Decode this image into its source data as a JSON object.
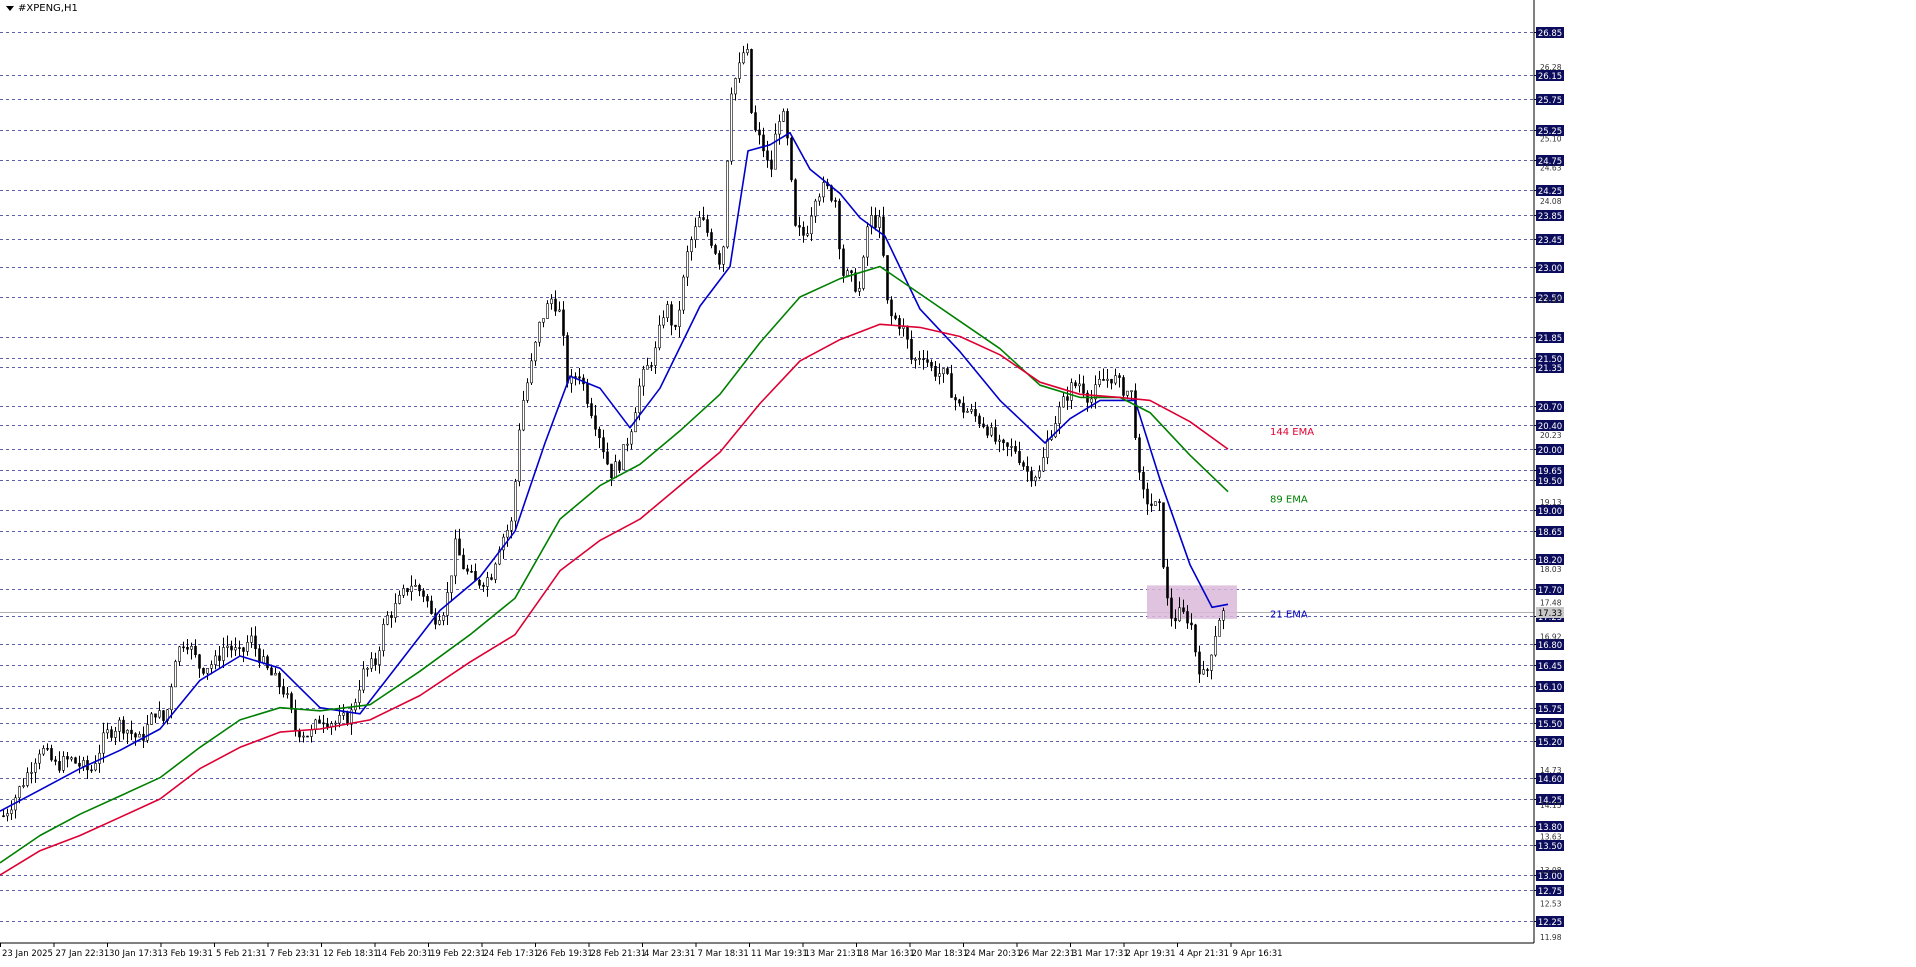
{
  "window": {
    "symbol_title": "#XPENG,H1"
  },
  "chart_data": {
    "type": "candlestick",
    "symbol": "#XPENG",
    "timeframe": "H1",
    "ylim": [
      11.9,
      27.15
    ],
    "grid": "horizontal dashed at marked levels",
    "levels": [
      "26.85",
      "26.15",
      "25.75",
      "25.25",
      "24.75",
      "24.25",
      "23.85",
      "23.45",
      "23.00",
      "22.50",
      "21.85",
      "21.50",
      "21.35",
      "20.70",
      "20.40",
      "20.00",
      "19.65",
      "19.50",
      "19.00",
      "18.65",
      "18.20",
      "17.70",
      "17.25",
      "16.80",
      "16.45",
      "16.10",
      "15.75",
      "15.50",
      "15.20",
      "14.60",
      "14.25",
      "13.80",
      "13.50",
      "13.00",
      "12.75",
      "12.25"
    ],
    "small_price_labels": [
      "26.28",
      "25.10",
      "24.63",
      "24.08",
      "22.45",
      "20.23",
      "19.13",
      "18.03",
      "17.48",
      "16.92",
      "14.73",
      "14.15",
      "13.63",
      "13.08",
      "12.53",
      "11.98"
    ],
    "current_price": "17.33",
    "x_labels": [
      "23 Jan 2025",
      "27 Jan 22:31",
      "30 Jan 17:31",
      "3 Feb 19:31",
      "5 Feb 21:31",
      "7 Feb 23:31",
      "12 Feb 18:31",
      "14 Feb 20:31",
      "19 Feb 22:31",
      "24 Feb 17:31",
      "26 Feb 19:31",
      "28 Feb 21:31",
      "4 Mar 23:31",
      "7 Mar 18:31",
      "11 Mar 19:31",
      "13 Mar 21:31",
      "18 Mar 16:31",
      "20 Mar 18:31",
      "24 Mar 20:31",
      "26 Mar 22:31",
      "31 Mar 17:31",
      "2 Apr 19:31",
      "4 Apr 21:31",
      "9 Apr 16:31"
    ],
    "x_positions": [
      0,
      53.5,
      107,
      160.5,
      214,
      267.5,
      321,
      374.5,
      428,
      481.5,
      535,
      588.5,
      642,
      695.5,
      749,
      802.5,
      856,
      909.5,
      963,
      1016.5,
      1070,
      1123.5,
      1177,
      1230.5
    ],
    "price_path": [
      [
        0,
        13.9
      ],
      [
        12,
        14.2
      ],
      [
        25,
        14.6
      ],
      [
        40,
        15.1
      ],
      [
        55,
        14.8
      ],
      [
        70,
        14.9
      ],
      [
        90,
        14.7
      ],
      [
        105,
        15.3
      ],
      [
        120,
        15.5
      ],
      [
        140,
        15.2
      ],
      [
        155,
        15.7
      ],
      [
        165,
        15.5
      ],
      [
        175,
        16.6
      ],
      [
        185,
        16.9
      ],
      [
        200,
        16.4
      ],
      [
        215,
        16.5
      ],
      [
        225,
        16.8
      ],
      [
        240,
        16.6
      ],
      [
        250,
        16.9
      ],
      [
        265,
        16.4
      ],
      [
        275,
        16.2
      ],
      [
        285,
        16.0
      ],
      [
        295,
        15.4
      ],
      [
        310,
        15.3
      ],
      [
        320,
        15.6
      ],
      [
        335,
        15.5
      ],
      [
        350,
        15.6
      ],
      [
        362,
        16.3
      ],
      [
        375,
        16.5
      ],
      [
        385,
        17.2
      ],
      [
        395,
        17.4
      ],
      [
        410,
        17.8
      ],
      [
        425,
        17.6
      ],
      [
        432,
        17.2
      ],
      [
        445,
        17.4
      ],
      [
        455,
        18.4
      ],
      [
        465,
        18.0
      ],
      [
        475,
        17.8
      ],
      [
        490,
        17.9
      ],
      [
        500,
        18.5
      ],
      [
        512,
        18.8
      ],
      [
        520,
        20.6
      ],
      [
        530,
        21.3
      ],
      [
        540,
        22.1
      ],
      [
        552,
        22.5
      ],
      [
        560,
        22.2
      ],
      [
        568,
        21.0
      ],
      [
        578,
        21.3
      ],
      [
        590,
        20.7
      ],
      [
        600,
        20.2
      ],
      [
        610,
        19.6
      ],
      [
        620,
        19.8
      ],
      [
        630,
        20.3
      ],
      [
        640,
        21.1
      ],
      [
        655,
        21.6
      ],
      [
        665,
        22.4
      ],
      [
        675,
        21.9
      ],
      [
        688,
        23.3
      ],
      [
        700,
        23.8
      ],
      [
        712,
        23.4
      ],
      [
        722,
        23.0
      ],
      [
        730,
        25.9
      ],
      [
        738,
        26.2
      ],
      [
        746,
        26.7
      ],
      [
        752,
        25.3
      ],
      [
        762,
        25.0
      ],
      [
        770,
        24.5
      ],
      [
        778,
        25.5
      ],
      [
        785,
        25.4
      ],
      [
        795,
        23.6
      ],
      [
        805,
        23.5
      ],
      [
        815,
        24.2
      ],
      [
        825,
        24.3
      ],
      [
        835,
        24.1
      ],
      [
        842,
        22.9
      ],
      [
        850,
        22.8
      ],
      [
        860,
        22.6
      ],
      [
        868,
        23.8
      ],
      [
        880,
        23.7
      ],
      [
        888,
        22.2
      ],
      [
        898,
        22.1
      ],
      [
        905,
        21.9
      ],
      [
        912,
        21.4
      ],
      [
        922,
        21.6
      ],
      [
        932,
        21.3
      ],
      [
        945,
        21.2
      ],
      [
        958,
        20.7
      ],
      [
        970,
        20.6
      ],
      [
        985,
        20.4
      ],
      [
        1000,
        20.0
      ],
      [
        1015,
        20.0
      ],
      [
        1028,
        19.6
      ],
      [
        1040,
        19.6
      ],
      [
        1048,
        20.2
      ],
      [
        1058,
        20.6
      ],
      [
        1070,
        21.0
      ],
      [
        1080,
        21.1
      ],
      [
        1090,
        20.8
      ],
      [
        1100,
        21.1
      ],
      [
        1112,
        21.2
      ],
      [
        1122,
        21.0
      ],
      [
        1132,
        20.9
      ],
      [
        1140,
        19.3
      ],
      [
        1150,
        19.1
      ],
      [
        1160,
        19.0
      ],
      [
        1165,
        17.6
      ],
      [
        1172,
        17.2
      ],
      [
        1180,
        17.3
      ],
      [
        1190,
        17.2
      ],
      [
        1197,
        16.5
      ],
      [
        1205,
        16.2
      ],
      [
        1212,
        16.8
      ],
      [
        1220,
        17.3
      ],
      [
        1226,
        17.3
      ]
    ],
    "series": [
      {
        "name": "21 EMA",
        "color": "#0000cc",
        "label_price": 17.28,
        "values": [
          [
            0,
            14.05
          ],
          [
            40,
            14.4
          ],
          [
            80,
            14.75
          ],
          [
            120,
            15.05
          ],
          [
            160,
            15.4
          ],
          [
            200,
            16.2
          ],
          [
            240,
            16.6
          ],
          [
            280,
            16.4
          ],
          [
            320,
            15.75
          ],
          [
            360,
            15.65
          ],
          [
            400,
            16.5
          ],
          [
            440,
            17.35
          ],
          [
            480,
            17.9
          ],
          [
            515,
            18.65
          ],
          [
            545,
            20.1
          ],
          [
            570,
            21.2
          ],
          [
            600,
            21.0
          ],
          [
            630,
            20.35
          ],
          [
            660,
            21.0
          ],
          [
            700,
            22.35
          ],
          [
            730,
            23.0
          ],
          [
            748,
            24.9
          ],
          [
            770,
            25.0
          ],
          [
            790,
            25.2
          ],
          [
            810,
            24.6
          ],
          [
            840,
            24.2
          ],
          [
            860,
            23.8
          ],
          [
            885,
            23.5
          ],
          [
            920,
            22.3
          ],
          [
            960,
            21.6
          ],
          [
            1000,
            20.8
          ],
          [
            1045,
            20.1
          ],
          [
            1070,
            20.5
          ],
          [
            1100,
            20.8
          ],
          [
            1135,
            20.8
          ],
          [
            1160,
            19.5
          ],
          [
            1190,
            18.1
          ],
          [
            1212,
            17.4
          ],
          [
            1228,
            17.45
          ]
        ]
      },
      {
        "name": "89 EMA",
        "color": "#008000",
        "label_price": 19.17,
        "values": [
          [
            0,
            13.2
          ],
          [
            40,
            13.65
          ],
          [
            80,
            14.0
          ],
          [
            120,
            14.3
          ],
          [
            160,
            14.6
          ],
          [
            200,
            15.1
          ],
          [
            240,
            15.55
          ],
          [
            280,
            15.75
          ],
          [
            320,
            15.7
          ],
          [
            370,
            15.8
          ],
          [
            420,
            16.35
          ],
          [
            470,
            16.95
          ],
          [
            515,
            17.55
          ],
          [
            560,
            18.85
          ],
          [
            600,
            19.4
          ],
          [
            640,
            19.75
          ],
          [
            680,
            20.3
          ],
          [
            720,
            20.9
          ],
          [
            760,
            21.75
          ],
          [
            800,
            22.5
          ],
          [
            840,
            22.8
          ],
          [
            880,
            23.0
          ],
          [
            920,
            22.55
          ],
          [
            960,
            22.1
          ],
          [
            1000,
            21.65
          ],
          [
            1040,
            21.05
          ],
          [
            1080,
            20.85
          ],
          [
            1120,
            20.85
          ],
          [
            1150,
            20.6
          ],
          [
            1190,
            19.9
          ],
          [
            1228,
            19.3
          ]
        ]
      },
      {
        "name": "144 EMA",
        "color": "#dd0033",
        "label_price": 20.28,
        "values": [
          [
            0,
            13.0
          ],
          [
            40,
            13.4
          ],
          [
            80,
            13.65
          ],
          [
            120,
            13.95
          ],
          [
            160,
            14.25
          ],
          [
            200,
            14.75
          ],
          [
            240,
            15.1
          ],
          [
            280,
            15.35
          ],
          [
            320,
            15.4
          ],
          [
            370,
            15.55
          ],
          [
            420,
            15.95
          ],
          [
            470,
            16.5
          ],
          [
            515,
            16.95
          ],
          [
            560,
            18.0
          ],
          [
            600,
            18.5
          ],
          [
            640,
            18.85
          ],
          [
            680,
            19.4
          ],
          [
            720,
            19.95
          ],
          [
            760,
            20.75
          ],
          [
            800,
            21.45
          ],
          [
            840,
            21.8
          ],
          [
            880,
            22.05
          ],
          [
            920,
            22.0
          ],
          [
            960,
            21.85
          ],
          [
            1000,
            21.55
          ],
          [
            1040,
            21.1
          ],
          [
            1080,
            20.9
          ],
          [
            1120,
            20.85
          ],
          [
            1150,
            20.8
          ],
          [
            1190,
            20.45
          ],
          [
            1228,
            20.0
          ]
        ]
      }
    ],
    "highlight_zone": {
      "x_from": 1147,
      "x_to": 1237,
      "price_from": 17.21,
      "price_to": 17.76,
      "color": "#d9b8d9"
    }
  }
}
